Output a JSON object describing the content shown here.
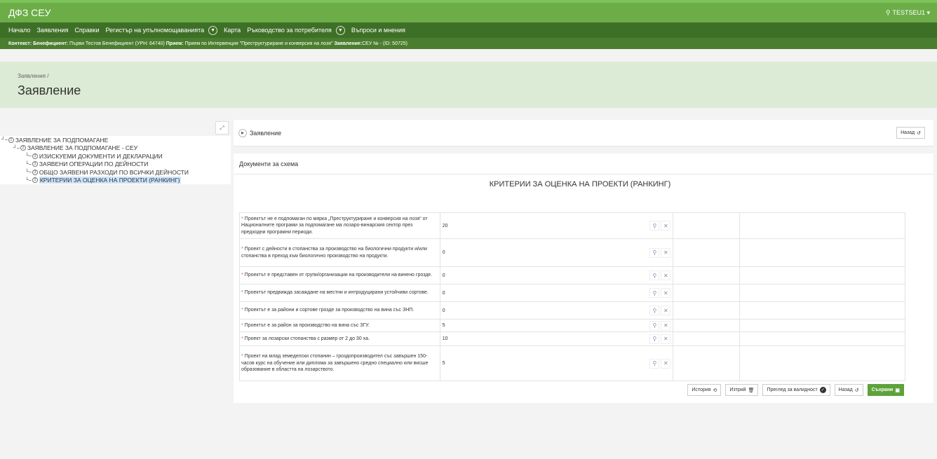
{
  "app": {
    "title": "ДФЗ СЕУ",
    "user": "TESTSEU1 ▾"
  },
  "menu": {
    "items": [
      "Начало",
      "Заявления",
      "Справки",
      "Регистър на упълномощаванията"
    ],
    "more": [
      "Карта",
      "Ръководство за потребителя"
    ],
    "last": "Въпроси и мнения"
  },
  "context": {
    "label": "Контекст:",
    "beneficiary_label": "Бенефициент:",
    "beneficiary": "Първи Тестов Бенефициент (УРН: 64740)",
    "intake_label": "Прием:",
    "intake": "Прием по Интервенция \"Преструктуриране и конверсия на лозя\"",
    "application_label": "Заявление:",
    "application": "СЕУ № - (ID: 50725)"
  },
  "header": {
    "breadcrumb": "Заявления /",
    "title": "Заявление"
  },
  "tree": [
    {
      "num": "1",
      "label": "ЗАЯВЛЕНИЕ ЗА ПОДПОМАГАНЕ",
      "level": 0
    },
    {
      "num": "2",
      "label": "ЗАЯВЛЕНИЕ ЗА ПОДПОМАГАНЕ - СЕУ",
      "level": 1
    },
    {
      "num": "3",
      "label": "ИЗИСКУЕМИ ДОКУМЕНТИ И ДЕКЛАРАЦИИ",
      "level": 2
    },
    {
      "num": "3",
      "label": "ЗАЯВЕНИ ОПЕРАЦИИ ПО ДЕЙНОСТИ",
      "level": 2
    },
    {
      "num": "3",
      "label": "ОБЩО ЗАЯВЕНИ РАЗХОДИ ПО ВСИЧКИ ДЕЙНОСТИ",
      "level": 2
    },
    {
      "num": "3",
      "label": "КРИТЕРИИ ЗА ОЦЕНКА НА ПРОЕКТИ (РАНКИНГ)",
      "level": 2,
      "selected": true
    }
  ],
  "panel": {
    "title": "Заявление",
    "back": "Назад",
    "docs_title": "Документи за схема",
    "criteria_title": "КРИТЕРИИ ЗА ОЦЕНКА НА ПРОЕКТИ (РАНКИНГ)"
  },
  "criteria": [
    {
      "text": "Проектът не е подпомаган по мярка „Преструктуриране и конверсия на лозя“ от Националните програми за подпомагане ма лозаро-винарския сектор през предходни програмни периоди.",
      "value": "20"
    },
    {
      "text": "Проект с дейности в стопанства за производство на биологични продукти и/или стопанства в преход към биологично производство на продукти.",
      "value": "0"
    },
    {
      "text": "Проектът е представен от групи/организации на производители на винено грозде.",
      "value": "0"
    },
    {
      "text": "Проектът предвижда засаждане на местни и интродуцирани устойчиви сортове.",
      "value": "0"
    },
    {
      "text": "Проектът е за райони и сортове грозде за производство на вина със ЗНП.",
      "value": "0"
    },
    {
      "text": "Проектът е за район за производство на вина със ЗГУ.",
      "value": "5"
    },
    {
      "text": "Проект за лозарски стопанства с размер от 2 до 30 ха.",
      "value": "10"
    },
    {
      "text": "Проект на млад земеделски стопанин – гроздопроизводител със завършен 150-часов курс на обучение или диплома за завършено средно специално или висше образование в областта на лозарството.",
      "value": "5"
    }
  ],
  "actions": {
    "history": "История",
    "delete": "Изтрий",
    "validate": "Преглед за валидност",
    "back": "Назад",
    "save": "Съхрани"
  },
  "colors": {
    "brand": "#6cad48",
    "menu": "#3e6f27",
    "context": "#4b7d2f",
    "header": "#dcebd5",
    "save": "#5ea23b"
  }
}
